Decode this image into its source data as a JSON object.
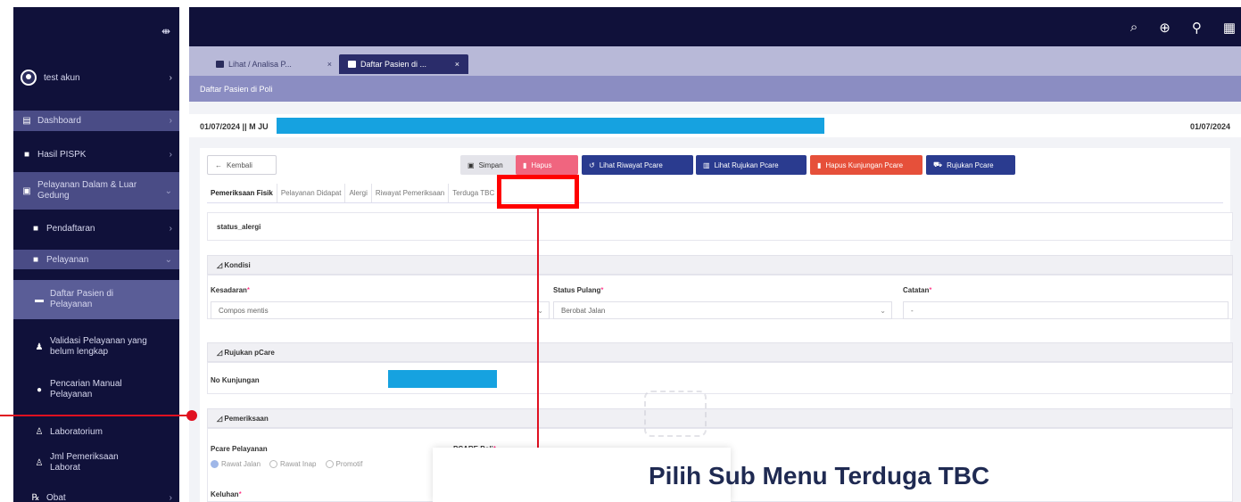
{
  "sidebar": {
    "user": "test akun",
    "items": [
      {
        "label": "Dashboard",
        "icon": "dashboard-icon"
      },
      {
        "label": "Hasil PISPK",
        "icon": "report-icon"
      },
      {
        "label": "Pelayanan Dalam & Luar",
        "label2": "Gedung",
        "icon": "building-icon"
      },
      {
        "label": "Pendaftaran",
        "icon": "register-icon"
      },
      {
        "label": "Pelayanan",
        "icon": "service-icon"
      },
      {
        "label": "Daftar Pasien di",
        "label2": "Pelayanan",
        "icon": "list-icon"
      },
      {
        "label": "Validasi Pelayanan yang",
        "label2": "belum lengkap",
        "icon": "user-check-icon"
      },
      {
        "label": "Pencarian Manual",
        "label2": "Pelayanan",
        "icon": "search-icon"
      },
      {
        "label": "Laboratorium",
        "icon": "lab-icon"
      },
      {
        "label": "Jml Pemeriksaan",
        "label2": "Laborat",
        "icon": "lab-count-icon"
      },
      {
        "label": "Obat",
        "icon": "rx-icon"
      }
    ]
  },
  "tabs": [
    {
      "label": "Lihat / Analisa P..."
    },
    {
      "label": "Daftar Pasien di ..."
    }
  ],
  "breadcrumb": "Daftar Pasien di Poli",
  "patient": {
    "date_left": "01/07/2024 || M JU",
    "date_right": "01/07/2024"
  },
  "buttons": {
    "back": "Kembali",
    "save": "Simpan",
    "delete": "Hapus",
    "history": "Lihat Riwayat Pcare",
    "referral": "Lihat Rujukan Pcare",
    "delete_visit": "Hapus Kunjungan Pcare",
    "referral_pcare": "Rujukan Pcare"
  },
  "subtabs": [
    "Pemeriksaan Fisik",
    "Pelayanan Didapat",
    "Alergi",
    "Riwayat Pemeriksaan",
    "Terduga TBC"
  ],
  "status_alergi": "status_alergi",
  "kondisi": {
    "title": "Kondisi",
    "kesadaran_label": "Kesadaran",
    "kesadaran_value": "Compos mentis",
    "status_label": "Status Pulang",
    "status_value": "Berobat Jalan",
    "catatan_label": "Catatan",
    "catatan_value": "-"
  },
  "rujukan": {
    "title": "Rujukan pCare",
    "no_label": "No Kunjungan"
  },
  "pemeriksaan": {
    "title": "Pemeriksaan",
    "pcare_label": "Pcare Pelayanan",
    "poli_label": "PCARE Poli",
    "options": [
      "Rawat Jalan",
      "Rawat Inap",
      "Promotif"
    ],
    "keluhan_label": "Keluhan"
  },
  "callout": "Pilih Sub Menu Terduga TBC",
  "colors": {
    "accent": "#10113a",
    "highlight": "#ff0000",
    "redaction": "#16a2e0"
  }
}
